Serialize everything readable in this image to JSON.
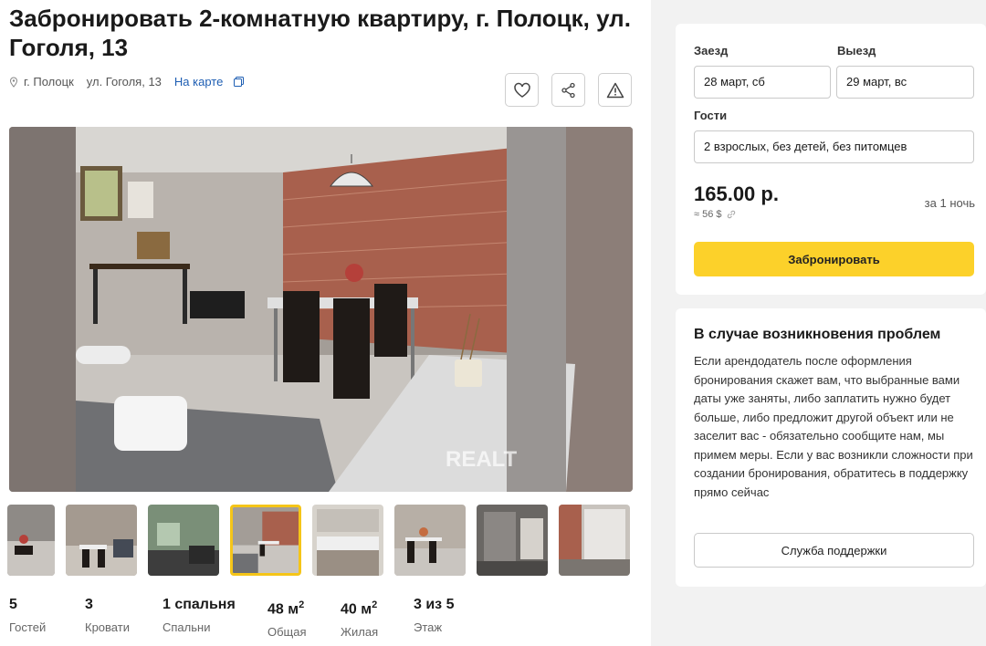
{
  "listing": {
    "title": "Забронировать 2-комнатную квартиру, г. Полоцк, ул. Гоголя, 13",
    "city": "г. Полоцк",
    "street": "ул. Гоголя, 13",
    "map_link": "На карте",
    "watermark": "REALT"
  },
  "icons": {
    "favorite": "heart-icon",
    "share": "share-icon",
    "report": "warning-icon",
    "location": "pin-icon",
    "copy": "copy-icon"
  },
  "gallery": {
    "thumbnail_count": 9,
    "active_index": 3
  },
  "stats": [
    {
      "value": "5",
      "label": "Гостей"
    },
    {
      "value": "3",
      "label": "Кровати"
    },
    {
      "value": "1 спальня",
      "label": "Спальни"
    },
    {
      "value": "48 м",
      "sup": "2",
      "label": "Общая"
    },
    {
      "value": "40 м",
      "sup": "2",
      "label": "Жилая"
    },
    {
      "value": "3 из 5",
      "label": "Этаж"
    }
  ],
  "booking": {
    "checkin_label": "Заезд",
    "checkout_label": "Выезд",
    "checkin_value": "28 март, сб",
    "checkout_value": "29 март, вс",
    "guests_label": "Гости",
    "guests_value": "2 взрослых, без детей, без питомцев",
    "price": "165.00 р.",
    "price_usd": "≈ 56 $",
    "period": "за 1 ночь",
    "book_button": "Забронировать"
  },
  "problems": {
    "title": "В случае возникновения проблем",
    "text": "Если арендодатель после оформления бронирования скажет вам, что выбранные вами даты уже заняты, либо заплатить нужно будет больше, либо предложит другой объект или не заселит вас - обязательно сообщите нам, мы примем меры. Если у вас возникли сложности при создании бронирования, обратитесь в поддержку прямо сейчас",
    "support_button": "Служба поддержки"
  },
  "colors": {
    "accent": "#fcd12a",
    "link": "#1e5eb3",
    "thumb_active": "#f5c518"
  }
}
